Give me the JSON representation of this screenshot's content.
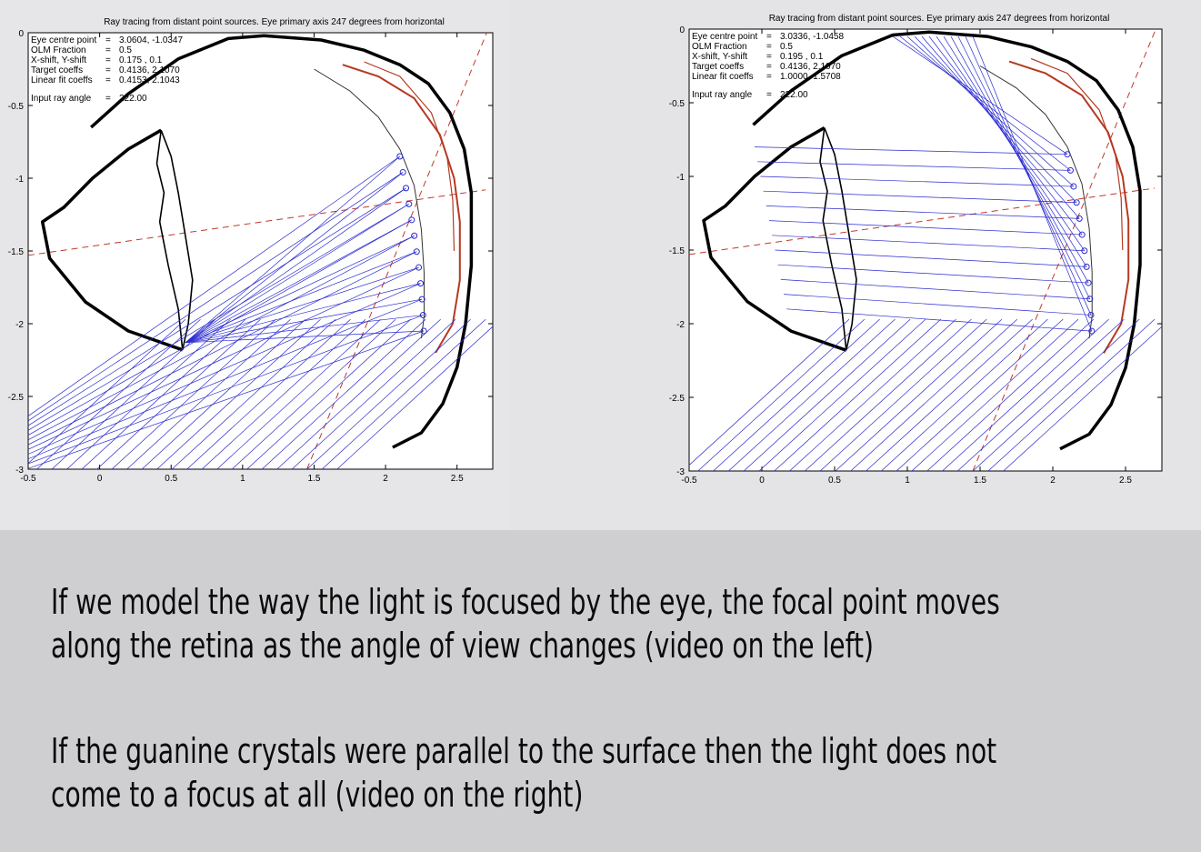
{
  "plots": [
    {
      "title": "Ray tracing from distant point sources.  Eye primary axis 247 degrees from horizontal",
      "info": [
        {
          "label": "Eye centre point",
          "value": "3.0604, -1.0347"
        },
        {
          "label": "OLM Fraction",
          "value": "0.5"
        },
        {
          "label": "X-shift, Y-shift",
          "value": "0.175 , 0.1"
        },
        {
          "label": "Target coeffs",
          "value": "0.4136, 2.1070"
        },
        {
          "label": "Linear fit coeffs",
          "value": "0.4153, 2.1043"
        }
      ],
      "input_ray_label": "Input ray angle",
      "input_ray_value": "222.00",
      "x_ticks": [
        "-0.5",
        "0",
        "0.5",
        "1",
        "1.5",
        "2",
        "2.5"
      ],
      "y_ticks": [
        "0",
        "-0.5",
        "-1",
        "-1.5",
        "-2",
        "-2.5",
        "-3"
      ]
    },
    {
      "title": "Ray tracing from distant point sources.  Eye primary axis 247 degrees from horizontal",
      "info": [
        {
          "label": "Eye centre point",
          "value": "3.0336, -1.0458"
        },
        {
          "label": "OLM Fraction",
          "value": "0.5"
        },
        {
          "label": "X-shift, Y-shift",
          "value": "0.195 , 0.1"
        },
        {
          "label": "Target coeffs",
          "value": "0.4136, 2.1070"
        },
        {
          "label": "Linear fit coeffs",
          "value": "1.0000, 1.5708"
        }
      ],
      "input_ray_label": "Input ray angle",
      "input_ray_value": "222.00",
      "x_ticks": [
        "-0.5",
        "0",
        "0.5",
        "1",
        "1.5",
        "2",
        "2.5"
      ],
      "y_ticks": [
        "0",
        "-0.5",
        "-1",
        "-1.5",
        "-2",
        "-2.5",
        "-3"
      ]
    }
  ],
  "captions": [
    "If we model the way the light is focused by the eye, the focal point moves along the retina as the angle of view changes (video on the left)",
    "If the guanine crystals were parallel to the surface then the light does not come to a focus at all (video on the right)"
  ],
  "caption_lines": [
    [
      "If we model the way the light is focused by the eye, the focal point moves",
      "along the retina as the angle of view changes (video on the left)"
    ],
    [
      "If the guanine crystals were parallel to the surface then the light does not",
      "come to a focus at all (video on the right)"
    ]
  ],
  "colors": {
    "rays": "#2a2ad0",
    "retina": "#b53a22",
    "axis_dash": "#c0392b",
    "outline": "#000000"
  }
}
